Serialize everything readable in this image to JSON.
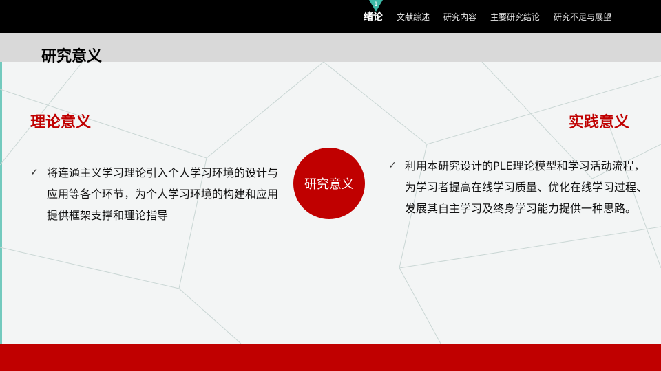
{
  "nav": {
    "marker_number": "1",
    "items": [
      {
        "label": "绪论"
      },
      {
        "label": "文献综述"
      },
      {
        "label": "研究内容"
      },
      {
        "label": "主要研究结论"
      },
      {
        "label": "研究不足与展望"
      }
    ]
  },
  "page": {
    "title": "研究意义"
  },
  "sections": {
    "left": {
      "heading": "理论意义",
      "text": "将连通主义学习理论引入个人学习环境的设计与应用等各个环节，为个人学习环境的构建和应用提供框架支撑和理论指导"
    },
    "right": {
      "heading": "实践意义",
      "text": "利用本研究设计的PLE理论模型和学习活动流程，为学习者提高在线学习质量、优化在线学习过程、发展其自主学习及终身学习能力提供一种思路。"
    }
  },
  "center": {
    "label": "研究意义"
  },
  "icons": {
    "bullet": "check-icon"
  },
  "colors": {
    "accent": "#c00000",
    "marker": "#3cb8a6",
    "topbar": "#000000"
  }
}
